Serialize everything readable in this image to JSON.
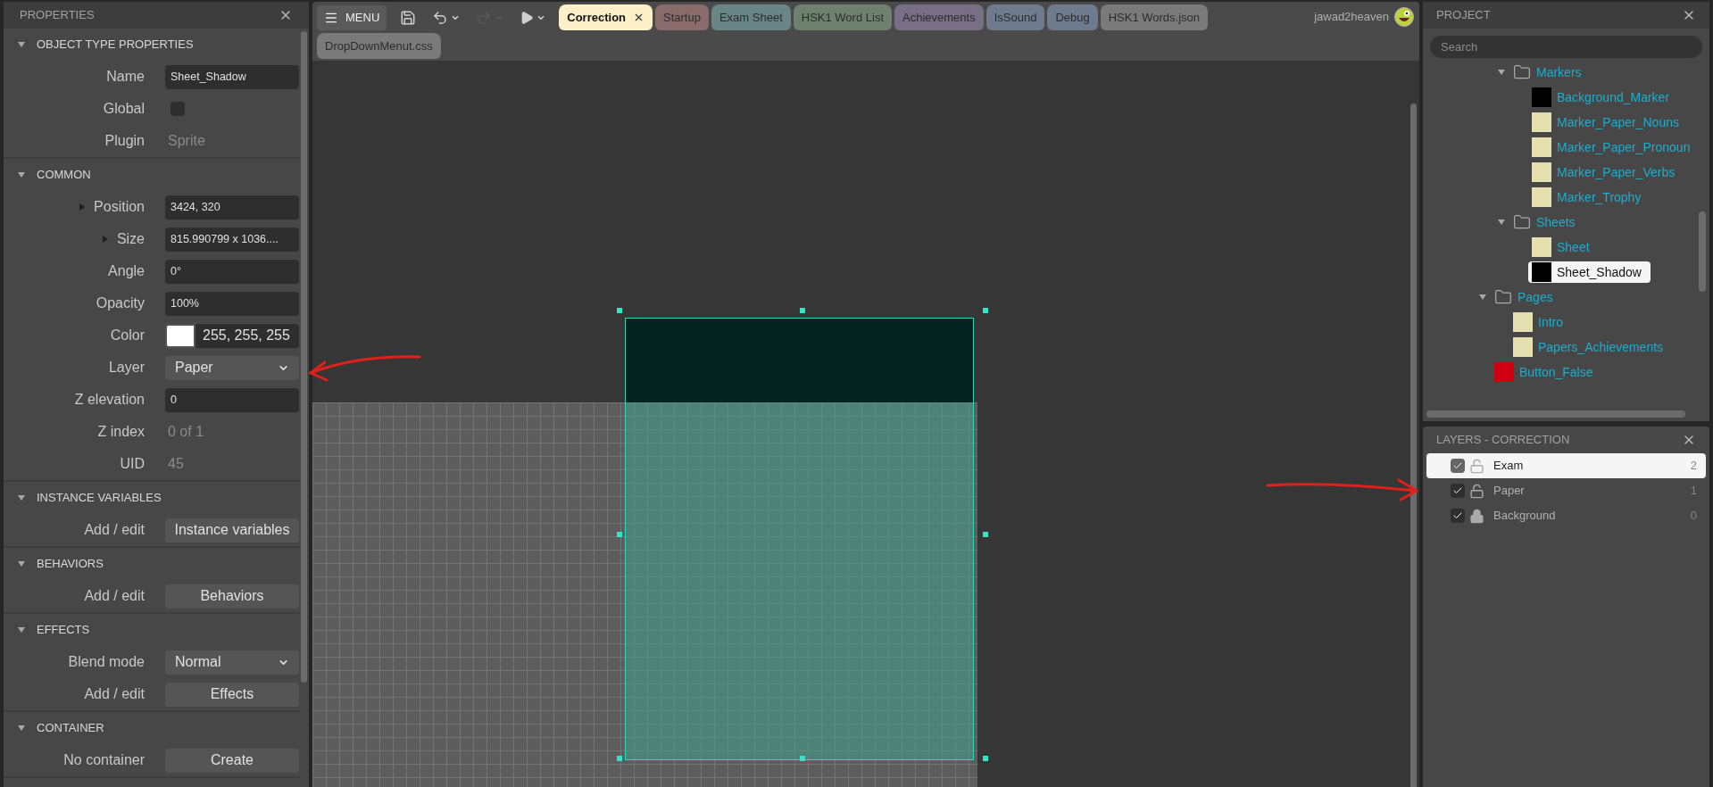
{
  "properties_panel": {
    "title": "PROPERTIES",
    "sections": [
      {
        "title": "OBJECT TYPE PROPERTIES",
        "expanded": true,
        "rows": [
          {
            "kind": "input",
            "label": "Name",
            "value": "Sheet_Shadow"
          },
          {
            "kind": "checkbox",
            "label": "Global",
            "checked": false
          },
          {
            "kind": "static",
            "label": "Plugin",
            "value": "Sprite"
          }
        ]
      },
      {
        "title": "COMMON",
        "expanded": true,
        "rows": [
          {
            "kind": "expandable",
            "label": "Position",
            "value": "3424, 320",
            "expanded": false
          },
          {
            "kind": "expandable",
            "label": "Size",
            "value": "815.990799 x 1036....",
            "expanded": false
          },
          {
            "kind": "input",
            "label": "Angle",
            "value": "0°"
          },
          {
            "kind": "input",
            "label": "Opacity",
            "value": "100%"
          },
          {
            "kind": "color",
            "label": "Color",
            "value": "255, 255, 255",
            "color": "#ffffff"
          },
          {
            "kind": "select",
            "label": "Layer",
            "value": "Paper"
          },
          {
            "kind": "input",
            "label": "Z elevation",
            "value": "0"
          },
          {
            "kind": "static",
            "label": "Z index",
            "value": "0 of 1"
          },
          {
            "kind": "static",
            "label": "UID",
            "value": "45"
          }
        ]
      },
      {
        "title": "INSTANCE VARIABLES",
        "expanded": true,
        "rows": [
          {
            "kind": "button",
            "label": "Add / edit",
            "value": "Instance variables"
          }
        ]
      },
      {
        "title": "BEHAVIORS",
        "expanded": true,
        "rows": [
          {
            "kind": "button",
            "label": "Add / edit",
            "value": "Behaviors"
          }
        ]
      },
      {
        "title": "EFFECTS",
        "expanded": true,
        "rows": [
          {
            "kind": "select",
            "label": "Blend mode",
            "value": "Normal"
          },
          {
            "kind": "button",
            "label": "Add / edit",
            "value": "Effects"
          }
        ]
      },
      {
        "title": "CONTAINER",
        "expanded": true,
        "rows": [
          {
            "kind": "button",
            "label": "No container",
            "value": "Create"
          }
        ]
      }
    ]
  },
  "toolbar": {
    "menu_button": "MENU",
    "buttons": [
      {
        "kind": "save",
        "disabled": false
      },
      {
        "kind": "undo",
        "disabled": false
      },
      {
        "kind": "redo",
        "disabled": true
      },
      {
        "kind": "play",
        "disabled": false
      }
    ]
  },
  "tabs": [
    {
      "label": "Correction",
      "selected": true,
      "color": "#fdf0c8"
    },
    {
      "label": "Startup",
      "selected": false,
      "color": "#8a6b6b"
    },
    {
      "label": "Exam Sheet",
      "selected": false,
      "color": "#6a8585"
    },
    {
      "label": "HSK1 Word List",
      "selected": false,
      "color": "#6e816e"
    },
    {
      "label": "Achievements",
      "selected": false,
      "color": "#786f87"
    },
    {
      "label": "IsSound",
      "selected": false,
      "color": "#6f7a8f"
    },
    {
      "label": "Debug",
      "selected": false,
      "color": "#6f7a8f"
    },
    {
      "label": "HSK1 Words.json",
      "selected": false,
      "color": "#7a7a7a"
    },
    {
      "label": "DropDownMenut.css",
      "selected": false,
      "color": "#7a7a7a"
    }
  ],
  "user": {
    "name": "jawad2heaven"
  },
  "project_panel": {
    "title": "PROJECT",
    "search": {
      "placeholder": "Search"
    },
    "tree": [
      {
        "kind": "group",
        "children": [
          {
            "kind": "folder",
            "label": "Markers",
            "expanded": true,
            "children": [
              {
                "kind": "sprite",
                "label": "Background_Marker",
                "color": "#000000",
                "selected": false
              },
              {
                "kind": "sprite",
                "label": "Marker_Paper_Nouns",
                "color": "#e6dfb0",
                "selected": false
              },
              {
                "kind": "sprite",
                "label": "Marker_Paper_Pronoun",
                "color": "#e6dfb0",
                "selected": false
              },
              {
                "kind": "sprite",
                "label": "Marker_Paper_Verbs",
                "color": "#e6dfb0",
                "selected": false
              },
              {
                "kind": "sprite",
                "label": "Marker_Trophy",
                "color": "#e6dfb0",
                "selected": false
              }
            ]
          },
          {
            "kind": "folder",
            "label": "Sheets",
            "expanded": true,
            "children": [
              {
                "kind": "sprite",
                "label": "Sheet",
                "color": "#e6dfb0",
                "selected": false
              },
              {
                "kind": "sprite",
                "label": "Sheet_Shadow",
                "color": "#000000",
                "selected": true
              }
            ]
          }
        ]
      },
      {
        "kind": "folder",
        "label": "Pages",
        "expanded": true,
        "children": [
          {
            "kind": "sprite",
            "label": "Intro",
            "color": "#e6dfb0",
            "selected": false
          },
          {
            "kind": "sprite",
            "label": "Papers_Achievements",
            "color": "#e6dfb0",
            "selected": false
          }
        ]
      },
      {
        "kind": "sprite",
        "label": "Button_False",
        "color": "#d00010",
        "selected": false
      }
    ]
  },
  "layers_panel": {
    "title": "LAYERS - CORRECTION",
    "layers": [
      {
        "name": "Exam",
        "visible": true,
        "locked": false,
        "selected": true,
        "index": "2"
      },
      {
        "name": "Paper",
        "visible": true,
        "locked": false,
        "selected": false,
        "index": "1"
      },
      {
        "name": "Background",
        "visible": true,
        "locked": true,
        "selected": false,
        "index": "0"
      }
    ]
  }
}
